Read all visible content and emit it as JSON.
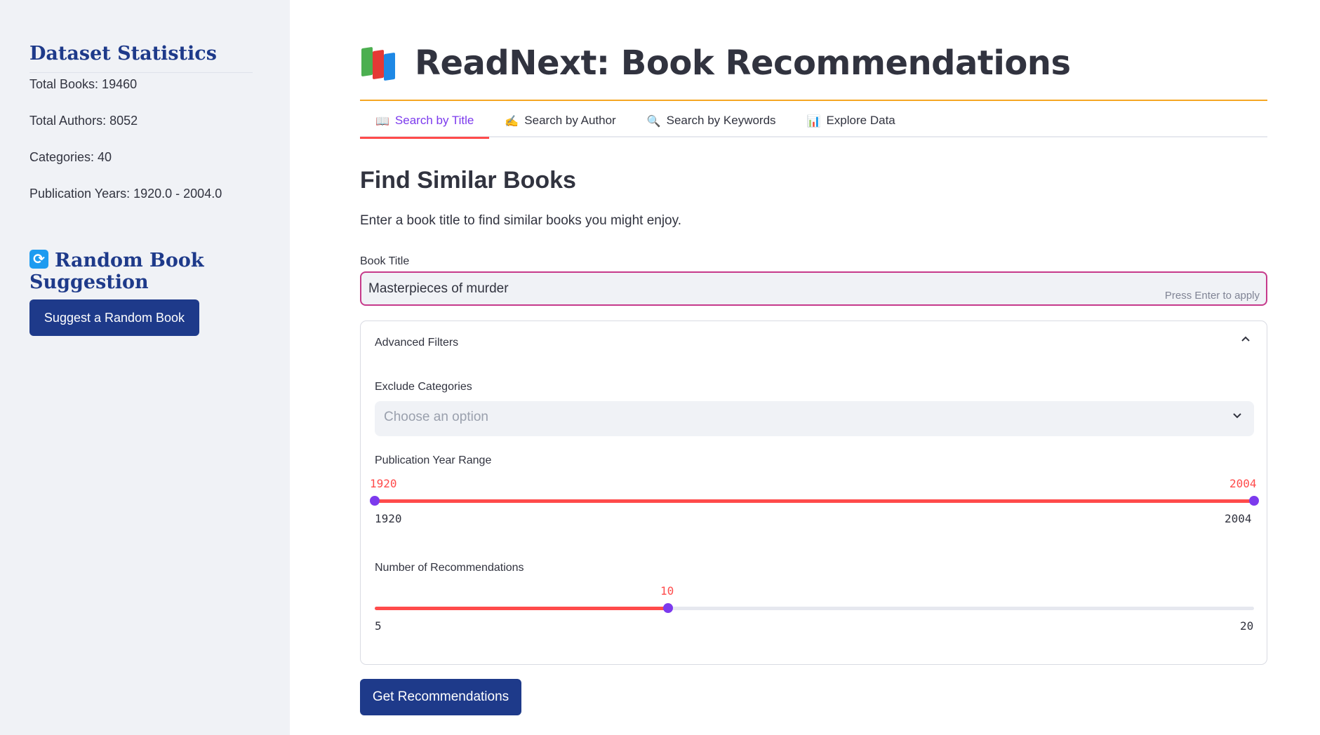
{
  "sidebar": {
    "stats_title": "Dataset Statistics",
    "stats": [
      "Total Books: 19460",
      "Total Authors: 8052",
      "Categories: 40",
      "Publication Years: 1920.0 - 2004.0"
    ],
    "random_title": "Random Book Suggestion",
    "random_icon": "refresh-icon",
    "random_button": "Suggest a Random Book"
  },
  "header": {
    "icon": "books-icon",
    "title": "ReadNext: Book Recommendations"
  },
  "tabs": [
    {
      "icon": "📖",
      "label": "Search by Title",
      "active": true
    },
    {
      "icon": "✍️",
      "label": "Search by Author",
      "active": false
    },
    {
      "icon": "🔍",
      "label": "Search by Keywords",
      "active": false
    },
    {
      "icon": "📊",
      "label": "Explore Data",
      "active": false
    }
  ],
  "section": {
    "title": "Find Similar Books",
    "description": "Enter a book title to find similar books you might enjoy.",
    "book_title_label": "Book Title",
    "book_title_value": "Masterpieces of murder",
    "press_enter_hint": "Press Enter to apply"
  },
  "filters": {
    "title": "Advanced Filters",
    "exclude_label": "Exclude Categories",
    "exclude_placeholder": "Choose an option",
    "year_label": "Publication Year Range",
    "year_min": "1920",
    "year_max": "2004",
    "year_selected_low": "1920",
    "year_selected_high": "2004",
    "rec_label": "Number of Recommendations",
    "rec_min": "5",
    "rec_max": "20",
    "rec_value": "10"
  },
  "actions": {
    "get_recommendations": "Get Recommendations"
  },
  "colors": {
    "accent": "#1e3a8a",
    "slider": "#ff4b4b",
    "thumb": "#7c3aed",
    "active_tab": "#7c3aed",
    "title_rule": "#f5a623"
  }
}
